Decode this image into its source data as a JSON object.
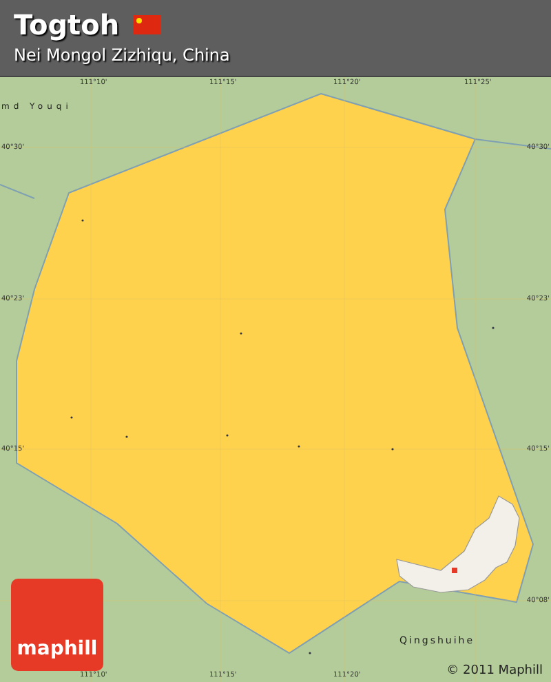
{
  "header": {
    "title": "Togtoh",
    "subtitle": "Nei Mongol Zizhiqu, China"
  },
  "map": {
    "longitude_ticks_top": [
      "111°10'",
      "111°15'",
      "111°20'",
      "111°25'"
    ],
    "longitude_ticks_bottom": [
      "111°10'",
      "111°15'",
      "111°20'"
    ],
    "latitude_ticks_left": [
      "40°30'",
      "40°23'",
      "40°15'"
    ],
    "latitude_ticks_right": [
      "40°30'",
      "40°23'",
      "40°15'",
      "40°08'"
    ],
    "neighbor_label": "md Youqi",
    "inset_label": "Qingshuihe"
  },
  "logo": "maphill",
  "copyright": "© 2011 Maphill"
}
